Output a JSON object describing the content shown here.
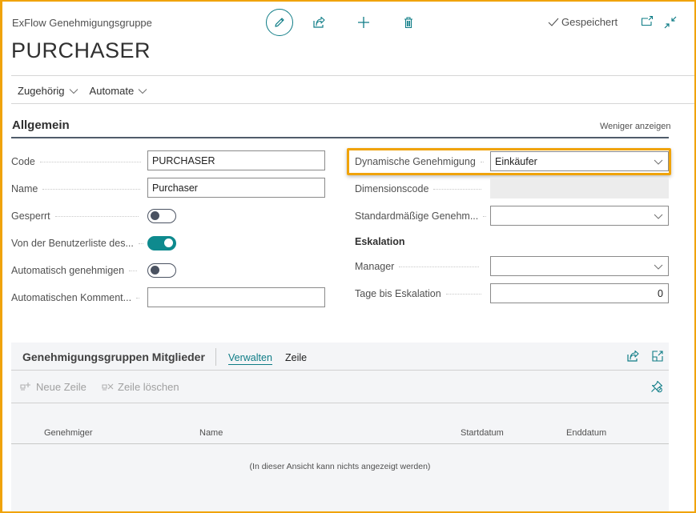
{
  "header": {
    "app_title": "ExFlow Genehmigungsgruppe",
    "record_title": "PURCHASER",
    "save_status": "Gespeichert",
    "actions": {
      "edit_icon": "pencil-icon",
      "share_icon": "share-icon",
      "new_icon": "plus-icon",
      "delete_icon": "trash-icon",
      "popout_icon": "open-in-new-window-icon",
      "collapse_icon": "collapse-icon"
    }
  },
  "menu": {
    "items": [
      {
        "label": "Zugehörig"
      },
      {
        "label": "Automate"
      }
    ]
  },
  "general": {
    "title": "Allgemein",
    "show_less": "Weniger anzeigen",
    "left_fields": [
      {
        "label": "Code",
        "value": "PURCHASER"
      },
      {
        "label": "Name",
        "value": "Purchaser"
      },
      {
        "label": "Gesperrt",
        "toggle": false
      },
      {
        "label": "Von der Benutzerliste des...",
        "toggle": true
      },
      {
        "label": "Automatisch genehmigen",
        "toggle": false
      },
      {
        "label": "Automatischen Komment...",
        "value": ""
      }
    ],
    "right_fields": [
      {
        "label": "Dynamische Genehmigung",
        "value": "Einkäufer"
      },
      {
        "label": "Dimensionscode",
        "value": ""
      },
      {
        "label": "Standardmäßige Genehm...",
        "value": ""
      }
    ],
    "escalation": {
      "title": "Eskalation",
      "fields": [
        {
          "label": "Manager",
          "value": ""
        },
        {
          "label": "Tage bis Eskalation",
          "value": "0"
        }
      ]
    },
    "highlight_color": "#f0a30a",
    "accent_color": "#0e7c86"
  },
  "members": {
    "title": "Genehmigungsgruppen Mitglieder",
    "tabs": [
      {
        "label": "Verwalten",
        "active": true
      },
      {
        "label": "Zeile",
        "active": false
      }
    ],
    "actions": [
      {
        "label": "Neue Zeile",
        "icon": "new-line-icon",
        "enabled": false
      },
      {
        "label": "Zeile löschen",
        "icon": "delete-line-icon",
        "enabled": false
      }
    ],
    "columns": [
      "Genehmiger",
      "Name",
      "Startdatum",
      "Enddatum"
    ],
    "rows": [],
    "empty_text": "(In dieser Ansicht kann nichts angezeigt werden)"
  }
}
